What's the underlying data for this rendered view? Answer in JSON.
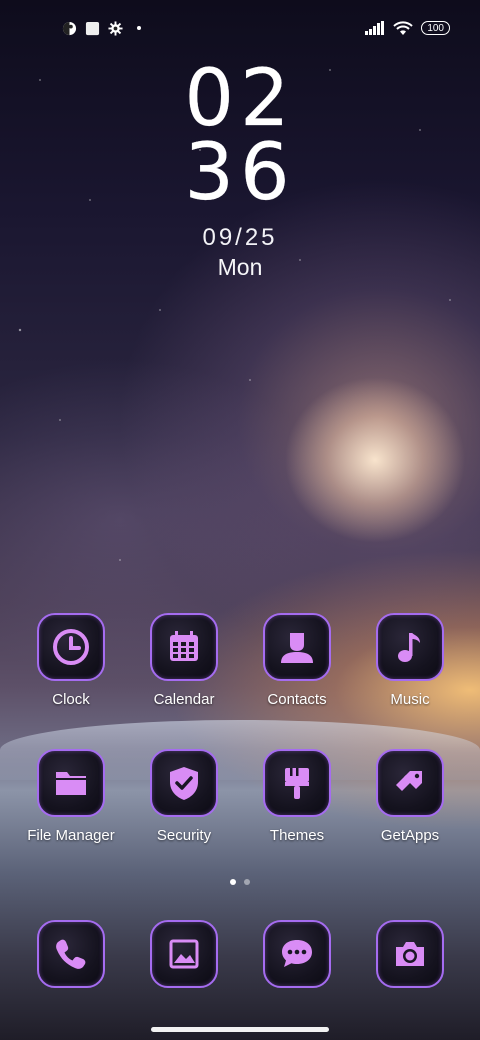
{
  "status_bar": {
    "left_icons": [
      "data-saver-icon",
      "square-icon",
      "settings-gear-icon",
      "dot-icon"
    ],
    "right_icons": [
      "signal-icon",
      "wifi-icon"
    ],
    "battery": "100"
  },
  "clock": {
    "hours": "02",
    "minutes": "36",
    "date": "09/25",
    "day": "Mon"
  },
  "apps": {
    "row1": [
      {
        "label": "Clock",
        "icon": "clock-icon"
      },
      {
        "label": "Calendar",
        "icon": "calendar-icon"
      },
      {
        "label": "Contacts",
        "icon": "contacts-icon"
      },
      {
        "label": "Music",
        "icon": "music-note-icon"
      }
    ],
    "row2": [
      {
        "label": "File Manager",
        "icon": "folder-icon"
      },
      {
        "label": "Security",
        "icon": "shield-check-icon"
      },
      {
        "label": "Themes",
        "icon": "paintbrush-icon"
      },
      {
        "label": "GetApps",
        "icon": "getapps-icon"
      }
    ]
  },
  "dock": [
    {
      "icon": "phone-icon"
    },
    {
      "icon": "gallery-icon"
    },
    {
      "icon": "messages-icon"
    },
    {
      "icon": "camera-icon"
    }
  ],
  "page_indicator": {
    "count": 2,
    "active": 1
  },
  "colors": {
    "accent": "#a56cf0",
    "icon_fill": "#d98cf5"
  }
}
